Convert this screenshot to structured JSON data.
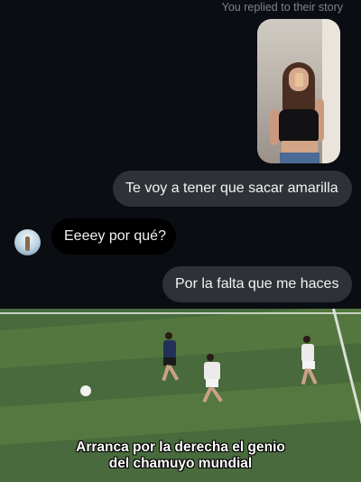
{
  "story_reply": {
    "note": "You replied to their story"
  },
  "messages": [
    {
      "direction": "outgoing",
      "text": "Te voy a tener que sacar amarilla"
    },
    {
      "direction": "incoming",
      "text": "Eeeey por qué?"
    },
    {
      "direction": "outgoing",
      "text": "Por la falta que me haces"
    }
  ],
  "video_caption": {
    "line1": "Arranca por la derecha el genio",
    "line2": "del chamuyo mundial"
  },
  "colors": {
    "chat_bg": "#0a0d12",
    "outgoing_bubble": "#2e3136",
    "incoming_bubble": "#000000",
    "pitch": "#486a3c"
  }
}
